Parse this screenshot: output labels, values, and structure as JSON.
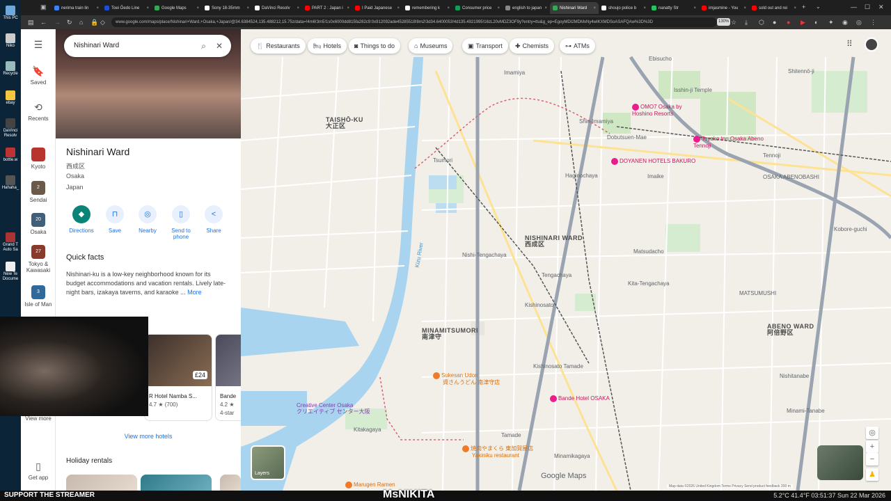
{
  "desktop": {
    "icons": [
      "This PC",
      "Niko",
      "Recycle",
      "ebay",
      "DaVinci Resolv",
      "bottle.w",
      "Hahaha_",
      "Grand T Auto Sa",
      "New Te Docume"
    ]
  },
  "browser": {
    "tabs": [
      {
        "label": "nerima train lin",
        "color": "#3b82f6"
      },
      {
        "label": "Toei Ōedo Line",
        "color": "#1d4ed8"
      },
      {
        "label": "Google Maps",
        "color": "#34a853"
      },
      {
        "label": "Sony 18-35mm",
        "color": "#ffffff"
      },
      {
        "label": "DaVinci Resolv",
        "color": "#ffffff"
      },
      {
        "label": "PART 2 : Japan i",
        "color": "#ff0000"
      },
      {
        "label": "I Paid Japanese",
        "color": "#ff0000"
      },
      {
        "label": "remembering k",
        "color": "#ffffff"
      },
      {
        "label": "Consumer price",
        "color": "#0f9d58"
      },
      {
        "label": "english to japan",
        "color": "#888888"
      },
      {
        "label": "Nishinari Ward",
        "color": "#34a853",
        "active": true
      },
      {
        "label": "shoujo police b",
        "color": "#ffffff"
      },
      {
        "label": "nanatty Str",
        "color": "#22c55e"
      },
      {
        "label": "imjasmine - You",
        "color": "#ff0000"
      },
      {
        "label": "sold out and rei",
        "color": "#ff0000"
      }
    ],
    "url": "www.google.com/maps/place/Nishinari+Ward,+Osaka,+Japan/@34.6384524,135.488212,15.75z/data=!4m6!3m5!1s0x6000dd815fa282c9:0x912092ade45285518!8m2!3d34.6400053!4d135.4921995!16zL20vMDZ3OF9y?entry=ttu&g_ep=EgoyMDI2MDMxNy4wIKXMDSoASAFQAw%3D%3D",
    "zoom": "130%"
  },
  "rail": {
    "menu_icon": "menu-icon",
    "saved": "Saved",
    "recents": "Recents",
    "places": [
      {
        "label": "Kyoto",
        "badge": "",
        "color": "#b7352c"
      },
      {
        "label": "Sendai",
        "badge": "2",
        "color": "#6b5a4a"
      },
      {
        "label": "Osaka",
        "badge": "20",
        "color": "#3f5f7a"
      },
      {
        "label": "Tokyo & Kawasaki",
        "badge": "27",
        "color": "#8a3a2a"
      },
      {
        "label": "Isle of Man",
        "badge": "3",
        "color": "#2f6a9a"
      }
    ],
    "view_more": "View more",
    "get_app": "Get app"
  },
  "panel": {
    "search_value": "Nishinari Ward",
    "title": "Nishinari Ward",
    "kanji": "西成区",
    "city": "Osaka",
    "country": "Japan",
    "actions": [
      {
        "label": "Directions",
        "icon": "directions-icon"
      },
      {
        "label": "Save",
        "icon": "bookmark-icon"
      },
      {
        "label": "Nearby",
        "icon": "nearby-icon"
      },
      {
        "label": "Send to phone",
        "icon": "phone-icon"
      },
      {
        "label": "Share",
        "icon": "share-icon"
      }
    ],
    "quick_facts_title": "Quick facts",
    "quick_facts_text": "Nishinari-ku is a low-key neighborhood known for its budget accommodations and vacation rentals. Lively late-night bars, izakaya taverns, and karaoke ... ",
    "more": "More",
    "hotels": [
      {
        "name": "R Hotel Namba S...",
        "price": "£24",
        "rating": "4.7 ★ (700)"
      },
      {
        "name": "Bande",
        "price": "",
        "rating": "4.2 ★",
        "stars": "4-star"
      }
    ],
    "view_more_hotels": "View more hotels",
    "holiday_rentals": "Holiday rentals"
  },
  "map": {
    "chips": [
      {
        "label": "Restaurants",
        "icon": "fork-knife-icon"
      },
      {
        "label": "Hotels",
        "icon": "bed-icon"
      },
      {
        "label": "Things to do",
        "icon": "camera-icon"
      },
      {
        "label": "Museums",
        "icon": "museum-icon"
      },
      {
        "label": "Transport",
        "icon": "bus-icon"
      },
      {
        "label": "Chemists",
        "icon": "pharmacy-icon"
      },
      {
        "label": "ATMs",
        "icon": "atm-icon"
      }
    ],
    "areas": [
      {
        "name": "TAISHŌ-KU",
        "kana": "大正区"
      },
      {
        "name": "NISHINARI WARD",
        "kana": "西成区"
      },
      {
        "name": "ABENO WARD",
        "kana": "阿倍野区"
      },
      {
        "name": "MINAMITSUMORI",
        "kana": "南津守"
      }
    ],
    "places": [
      "Ebisucho",
      "Imamiya",
      "Isshin-ji Temple",
      "Shitennō-ji",
      "Shin-Imamiya",
      "Dobutsuen-Mae",
      "Haginochaya",
      "Imaike",
      "Tennoji",
      "OSAKA ABENOBASHI",
      "Tsumori",
      "Kobore-guchi",
      "Matsudacho",
      "Nishi-Tengachaya",
      "Tengachaya",
      "Kita-Tengachaya",
      "MATSUMUSHI",
      "Kishinosato",
      "Kishinosato Tamade",
      "Tamade",
      "Kitakagaya",
      "Nishitanabe",
      "Minami-Tanabe",
      "Minamikagaya",
      "Kizu River"
    ],
    "pois": [
      {
        "label": "OMO7 Osaka by Hoshino Resorts",
        "kind": "hotel"
      },
      {
        "label": "Toyoko Inn Osaka Abeno Tennoji",
        "kind": "hotel"
      },
      {
        "label": "DOYANEN HOTELS BAKURO",
        "kind": "hotel"
      },
      {
        "label": "Bande Hotel OSAKA",
        "kind": "hotel"
      },
      {
        "label": "Sukesan Udon",
        "kana": "資さんうどん 南津守店",
        "kind": "food"
      },
      {
        "label": "Yakiniku restaurant",
        "kana": "焼肉やまくら 東加賀屋店",
        "kind": "food"
      },
      {
        "label": "Marugen Ramen",
        "kind": "food"
      },
      {
        "label": "Creative Center Osaka",
        "kana": "クリエイティブ センター大阪",
        "kind": "place"
      }
    ],
    "layers_label": "Layers",
    "logo": "Google Maps",
    "attribution": "Map data ©2026    United Kingdom    Terms    Privacy    Send product feedback    200 m"
  },
  "taskbar": {
    "left_text": "SUPPORT THE STREAMER",
    "mid_text": "MsNIKITA",
    "status": "5.2°C  41.4°F  03:51:37  Sun 22 Mar 2026"
  }
}
